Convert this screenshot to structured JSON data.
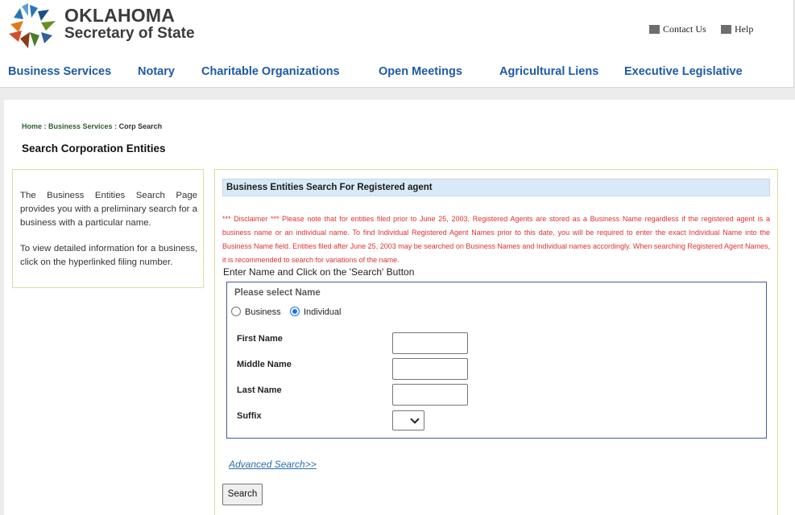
{
  "header": {
    "logo_line1": "OKLAHOMA",
    "logo_line2": "Secretary of State",
    "contact_label": "Contact Us",
    "help_label": "Help"
  },
  "nav": {
    "items": [
      "Business Services",
      "Notary",
      "Charitable Organizations",
      "Open Meetings",
      "Agricultural Liens",
      "Executive Legislative"
    ]
  },
  "breadcrumb": {
    "home": "Home",
    "sep": " : ",
    "business_services": "Business Services",
    "current": "Corp Search"
  },
  "page_title": "Search Corporation Entities",
  "sidebar": {
    "para1": "The Business Entities Search Page provides you with a preliminary search for a business with a particular name.",
    "para2": "To view detailed information for a business, click on the hyperlinked filing number."
  },
  "search": {
    "heading": "Business Entities Search For Registered agent",
    "disclaimer": "*** Disclaimer *** Please note that for entities filed prior to June 25, 2003, Registered Agents are stored as a Business Name regardless if the registered agent is a business name or an individual name. To find Individual Registered Agent Names prior to this date, you will be required to enter the exact Individual Name into the Business Name field. Entities filed after June 25, 2003 may be searched on Business Names and Individual names accordingly. When searching Registered Agent Names, it is recommended to search for variations of the name.",
    "instruction": "Enter Name and Click on the 'Search' Button",
    "legend": "Please select Name",
    "radio_business": "Business",
    "radio_individual": "Individual",
    "selected_radio": "Individual",
    "first_name_label": "First Name",
    "middle_name_label": "Middle Name",
    "last_name_label": "Last Name",
    "suffix_label": "Suffix",
    "first_name_value": "",
    "middle_name_value": "",
    "last_name_value": "",
    "suffix_value": "",
    "advanced_link": "Advanced Search>>",
    "search_button": "Search"
  },
  "colors": {
    "nav_blue": "#1f5aa6",
    "disclaimer_red": "#e03030",
    "section_head_bg": "#d9eaf7",
    "fieldset_border": "#3f5e8e",
    "panel_border": "#dcdca5"
  }
}
